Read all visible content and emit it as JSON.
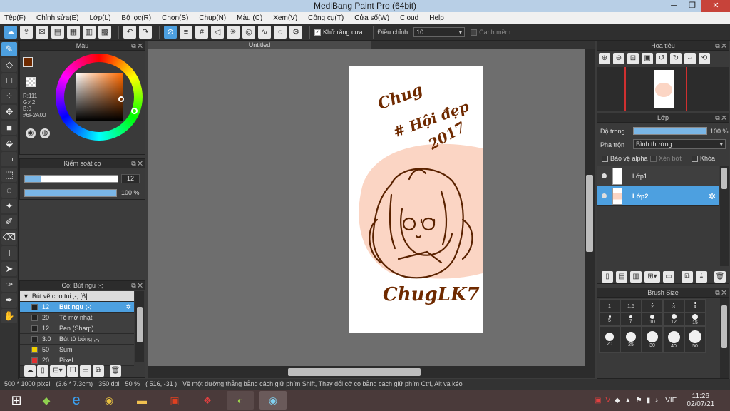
{
  "app": {
    "title": "MediBang Paint Pro (64bit)"
  },
  "menu": [
    "Tệp(F)",
    "Chỉnh sửa(E)",
    "Lớp(L)",
    "Bộ lọc(R)",
    "Chọn(S)",
    "Chụp(N)",
    "Màu (C)",
    "Xem(V)",
    "Công cụ(T)",
    "Cửa sổ(W)",
    "Cloud",
    "Help"
  ],
  "toolbar": {
    "antialias_label": "Khử răng cưa",
    "adjust_label": "Điều chỉnh",
    "adjust_value": "10",
    "edge_label": "Canh mềm"
  },
  "color_panel": {
    "title": "Màu",
    "r": "R:111",
    "g": "G:42",
    "b": "B:0",
    "hex": "#6F2A00",
    "current_color": "#6F2A00"
  },
  "brush_control": {
    "title": "Kiểm soát cọ",
    "size_value": "12",
    "size_fraction": 0.18,
    "opacity_value": "100 %",
    "opacity_fraction": 1.0
  },
  "brush_panel": {
    "title": "Cọ: Bút ngu ;-;",
    "group": "Bút vẽ cho tui ;-; [6]",
    "items": [
      {
        "size": "12",
        "name": "Bút ngu ;-;",
        "color": "#1e1e1e",
        "selected": true
      },
      {
        "size": "20",
        "name": "Tô mờ nhạt",
        "color": "#1e1e1e"
      },
      {
        "size": "12",
        "name": "Pen (Sharp)",
        "color": "#1e1e1e"
      },
      {
        "size": "3.0",
        "name": "Bút tô bóng ;-;",
        "color": "#1e1e1e"
      },
      {
        "size": "50",
        "name": "Sumi",
        "color": "#f0d000"
      },
      {
        "size": "20",
        "name": "Pixel",
        "color": "#e03030"
      }
    ]
  },
  "canvas": {
    "tab_title": "Untitled",
    "drawing_text_top": "Chug",
    "drawing_text_hashtag": "# Hội đẹp",
    "drawing_text_year": "2017",
    "signature": "ChugLK7"
  },
  "navigator": {
    "title": "Hoa tiêu"
  },
  "layers": {
    "title": "Lớp",
    "opacity_label": "Độ trong",
    "opacity_value": "100 %",
    "opacity_fraction": 1.0,
    "blend_label": "Pha trộn",
    "blend_value": "Bình thường",
    "protect_alpha": "Bảo vệ alpha",
    "clip": "Xén bớt",
    "lock": "Khóa",
    "items": [
      {
        "name": "Lớp1",
        "selected": false
      },
      {
        "name": "Lớp2",
        "selected": true
      }
    ]
  },
  "brush_size": {
    "title": "Brush Size",
    "rows": [
      [
        "1",
        "1.5",
        "2",
        "3",
        "4"
      ],
      [
        "5",
        "7",
        "10",
        "12",
        "15"
      ],
      [
        "20",
        "25",
        "30",
        "40",
        "50"
      ]
    ]
  },
  "status": {
    "size": "500 * 1000 pixel",
    "dims": "(3.6 * 7.3cm)",
    "dpi": "350 dpi",
    "zoom": "50 %",
    "coords": "( 516, -31 )",
    "hint": "Vẽ một đường thẳng bằng cách giữ phím Shift, Thay đổi cỡ cọ bằng cách giữ phím Ctrl, Alt và kéo"
  },
  "taskbar": {
    "lang": "VIE",
    "time": "11:26",
    "date": "02/07/21"
  }
}
